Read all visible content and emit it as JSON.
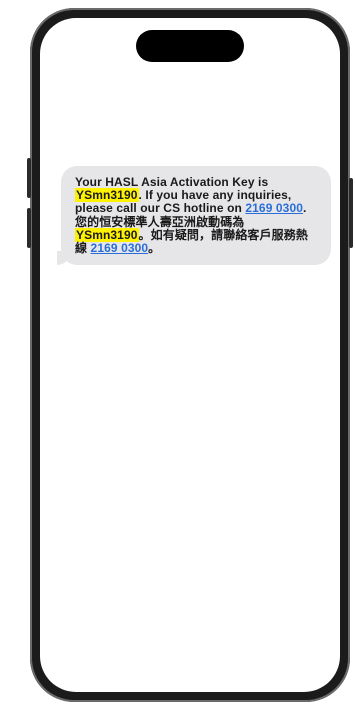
{
  "message": {
    "text_1": "Your HASL Asia Activation Key is ",
    "key_1": "YSmn3190",
    "text_2": ". If you have any inquiries, please call our CS hotline on ",
    "phone_1": "2169 0300",
    "text_3": ". 您的恒安標準人壽亞洲啟動碼為 ",
    "key_2": "YSmn3190",
    "text_4": "。如有疑問，請聯絡客戶服務熱線 ",
    "phone_2": "2169 0300",
    "text_5": "。",
    "colors": {
      "bubble_bg": "#e6e6e9",
      "highlight": "#fff200",
      "link": "#2a6fd9"
    }
  }
}
